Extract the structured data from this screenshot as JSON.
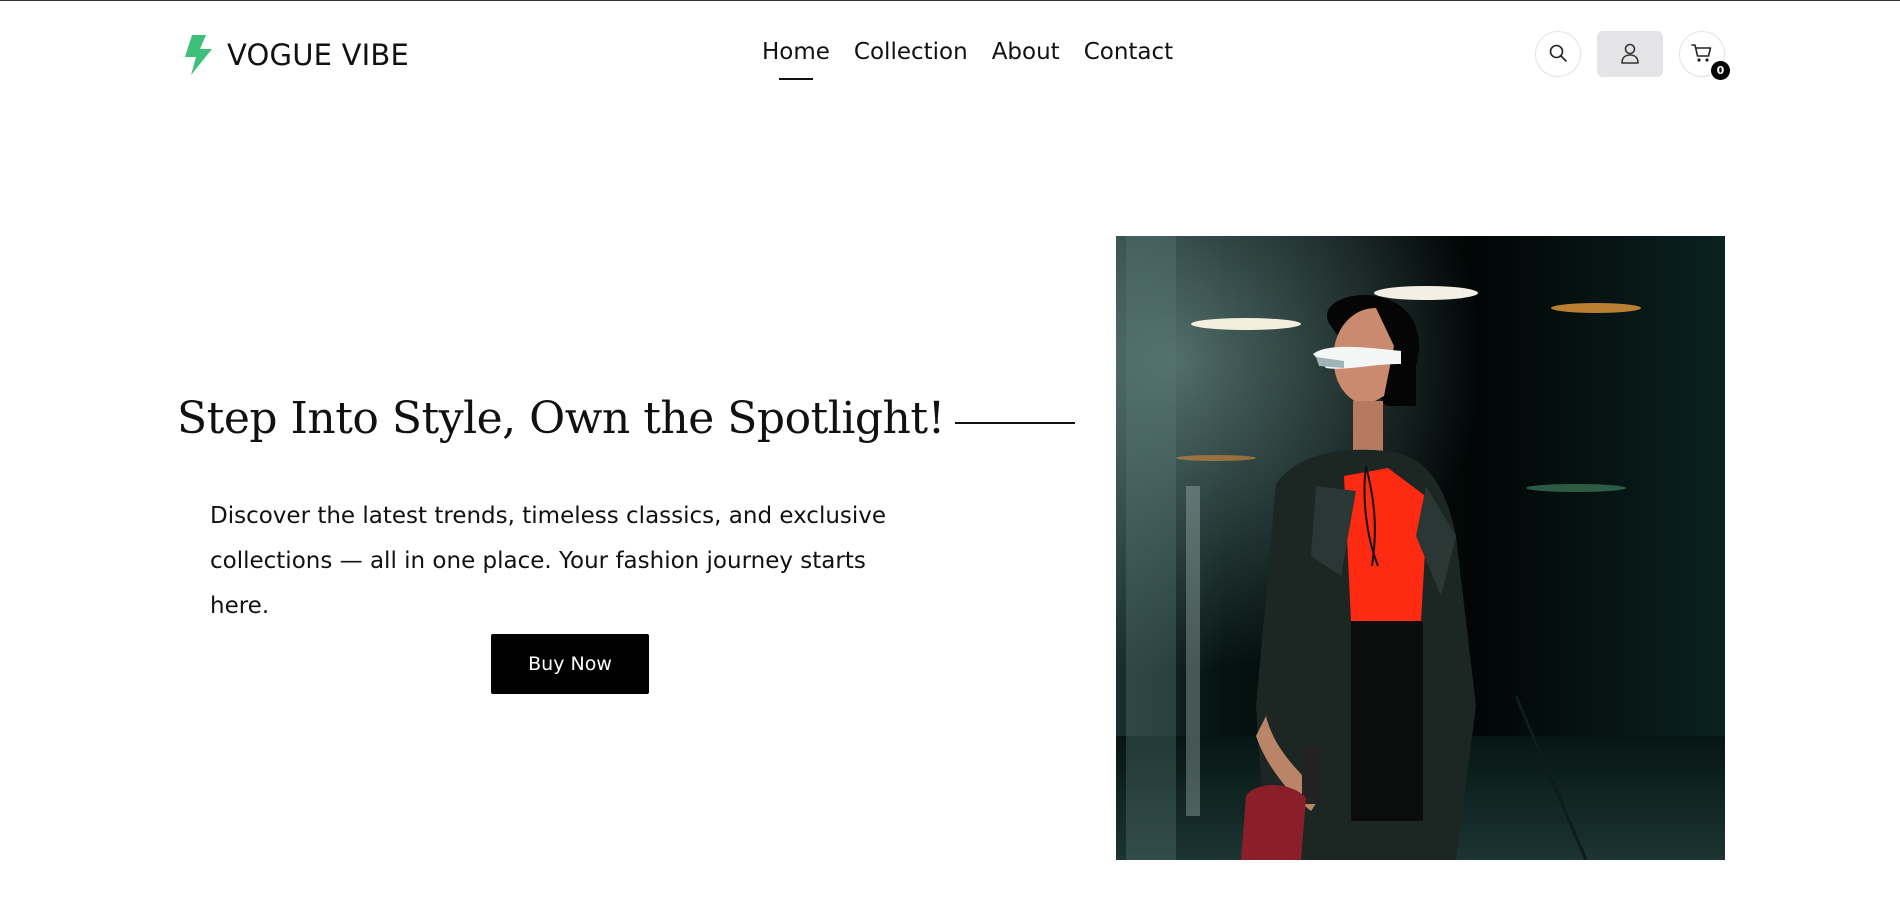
{
  "brand": {
    "name": "VOGUE VIBE",
    "logo_icon": "lightning-bolt-icon",
    "logo_color": "#3cc07a"
  },
  "nav": {
    "items": [
      {
        "label": "Home",
        "active": true
      },
      {
        "label": "Collection",
        "active": false
      },
      {
        "label": "About",
        "active": false
      },
      {
        "label": "Contact",
        "active": false
      }
    ]
  },
  "header_actions": {
    "search_icon": "search-icon",
    "account_icon": "user-icon",
    "cart_icon": "cart-icon",
    "cart_count": "0"
  },
  "hero": {
    "title": "Step Into Style, Own the Spotlight!",
    "description": "Discover the latest trends, timeless classics, and exclusive collections — all in one place. Your fashion journey starts here.",
    "cta_label": "Buy Now"
  },
  "colors": {
    "accent": "#3cc07a",
    "button_bg": "#000000",
    "account_bg": "#e4e4e6",
    "shirt_red": "#ff2a12"
  }
}
